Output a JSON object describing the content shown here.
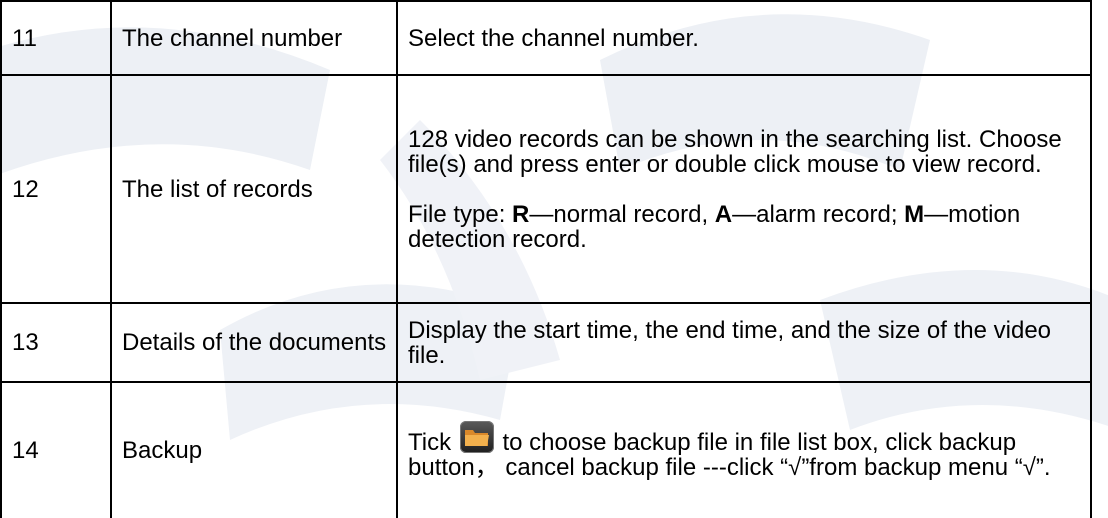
{
  "table": {
    "rows": [
      {
        "number": "11",
        "name": "The channel number",
        "desc": [
          "Select the channel number."
        ]
      },
      {
        "number": "12",
        "name": "The list of records",
        "desc": [
          "128 video records can be shown in the searching list. Choose file(s) and press enter or double click mouse to view record.",
          ""
        ],
        "filetype": {
          "prefix": "File type: ",
          "r_letter": "R",
          "r_text": "—normal record, ",
          "a_letter": "A",
          "a_text": "—alarm record;",
          "m_letter": "M",
          "m_text": "—motion detection record."
        }
      },
      {
        "number": "13",
        "name": "Details of the documents",
        "desc": [
          "Display the start time, the end time, and the size of the video file."
        ]
      },
      {
        "number": "14",
        "name": "Backup",
        "backup": {
          "before_icon": "Tick ",
          "icon": "folder-icon",
          "after_icon": " to choose backup file in file list box, click backup button， cancel backup file ---click “√”from backup menu “√”."
        }
      }
    ]
  },
  "colors": {
    "border": "#000000",
    "text": "#000000",
    "watermark": "#eef1f6"
  }
}
